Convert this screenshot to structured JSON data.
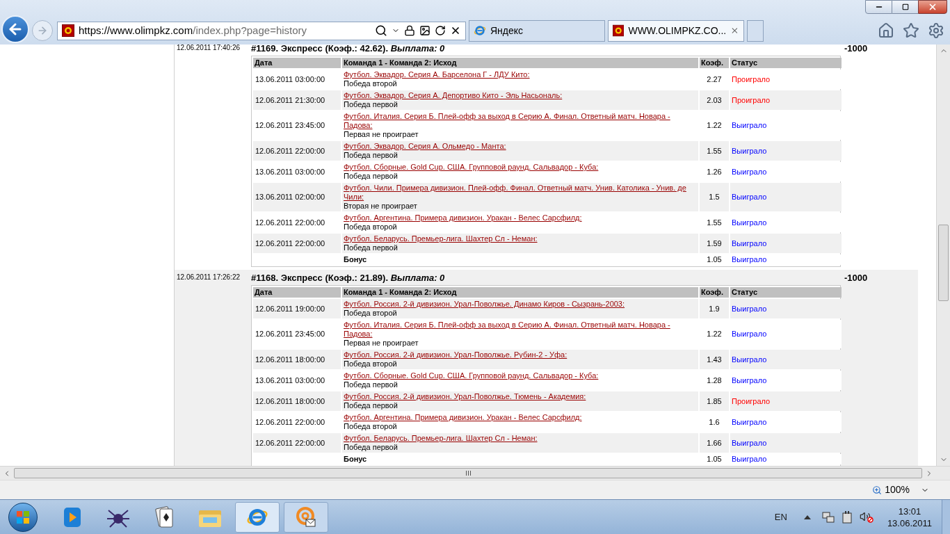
{
  "address_bar": {
    "url_host": "https://www.olimpkz.com",
    "url_path": "/index.php?page=history"
  },
  "tabs": [
    {
      "label": "Яндекс",
      "selected": false
    },
    {
      "label": "WWW.OLIMPKZ.CO...",
      "selected": true
    }
  ],
  "bets": [
    {
      "placed": "12.06.2011 17:40:26",
      "title": "#1169. Экспресс (Коэф.: 42.62).",
      "payout": "Выплата: 0",
      "amount": "-1000",
      "columns": [
        "Дата",
        "Команда 1 - Команда 2: Исход",
        "Коэф.",
        "Статус"
      ],
      "rows": [
        {
          "kind": "event",
          "date": "13.06.2011 03:00:00",
          "match": "Футбол. Эквадор. Серия А. Барселона Г - ЛДУ Кито:",
          "outcome": "Победа второй",
          "coef": "2.27",
          "status": "Проиграло",
          "won": false
        },
        {
          "kind": "event",
          "date": "12.06.2011 21:30:00",
          "match": "Футбол. Эквадор. Серия А. Депортиво Кито - Эль Насьональ:",
          "outcome": "Победа первой",
          "coef": "2.03",
          "status": "Проиграло",
          "won": false
        },
        {
          "kind": "event",
          "date": "12.06.2011 23:45:00",
          "match": "Футбол. Италия. Серия Б. Плей-офф за выход в Серию А. Финал. Ответный матч. Новара - Падова:",
          "outcome": "Первая не проиграет",
          "coef": "1.22",
          "status": "Выиграло",
          "won": true
        },
        {
          "kind": "event",
          "date": "12.06.2011 22:00:00",
          "match": "Футбол. Эквадор. Серия А. Ольмедо - Манта:",
          "outcome": "Победа первой",
          "coef": "1.55",
          "status": "Выиграло",
          "won": true
        },
        {
          "kind": "event",
          "date": "13.06.2011 03:00:00",
          "match": "Футбол. Сборные. Gold Cup. США. Групповой раунд. Сальвадор - Куба:",
          "outcome": "Победа первой",
          "coef": "1.26",
          "status": "Выиграло",
          "won": true
        },
        {
          "kind": "event",
          "date": "13.06.2011 02:00:00",
          "match": "Футбол. Чили. Примера дивизион. Плей-офф. Финал. Ответный матч. Унив. Католика - Унив. де Чили:",
          "outcome": "Вторая не проиграет",
          "coef": "1.5",
          "status": "Выиграло",
          "won": true
        },
        {
          "kind": "event",
          "date": "12.06.2011 22:00:00",
          "match": "Футбол. Аргентина. Примера дивизион. Уракан - Велес Сарсфилд:",
          "outcome": "Победа второй",
          "coef": "1.55",
          "status": "Выиграло",
          "won": true
        },
        {
          "kind": "event",
          "date": "12.06.2011 22:00:00",
          "match": "Футбол. Беларусь. Премьер-лига. Шахтер Сл - Неман:",
          "outcome": "Победа первой",
          "coef": "1.59",
          "status": "Выиграло",
          "won": true
        },
        {
          "kind": "bonus",
          "label": "Бонус",
          "coef": "1.05",
          "status": "Выиграло",
          "won": true
        }
      ]
    },
    {
      "placed": "12.06.2011 17:26:22",
      "title": "#1168. Экспресс (Коэф.: 21.89).",
      "payout": "Выплата: 0",
      "amount": "-1000",
      "columns": [
        "Дата",
        "Команда 1 - Команда 2: Исход",
        "Коэф.",
        "Статус"
      ],
      "rows": [
        {
          "kind": "event",
          "date": "12.06.2011 19:00:00",
          "match": "Футбол. Россия. 2-й дивизион. Урал-Поволжье. Динамо Киров - Сызрань-2003:",
          "outcome": "Победа второй",
          "coef": "1.9",
          "status": "Выиграло",
          "won": true
        },
        {
          "kind": "event",
          "date": "12.06.2011 23:45:00",
          "match": "Футбол. Италия. Серия Б. Плей-офф за выход в Серию А. Финал. Ответный матч. Новара - Падова:",
          "outcome": "Первая не проиграет",
          "coef": "1.22",
          "status": "Выиграло",
          "won": true
        },
        {
          "kind": "event",
          "date": "12.06.2011 18:00:00",
          "match": "Футбол. Россия. 2-й дивизион. Урал-Поволжье. Рубин-2 - Уфа:",
          "outcome": "Победа второй",
          "coef": "1.43",
          "status": "Выиграло",
          "won": true
        },
        {
          "kind": "event",
          "date": "13.06.2011 03:00:00",
          "match": "Футбол. Сборные. Gold Cup. США. Групповой раунд. Сальвадор - Куба:",
          "outcome": "Победа первой",
          "coef": "1.28",
          "status": "Выиграло",
          "won": true
        },
        {
          "kind": "event",
          "date": "12.06.2011 18:00:00",
          "match": "Футбол. Россия. 2-й дивизион. Урал-Поволжье. Тюмень - Академия:",
          "outcome": "Победа первой",
          "coef": "1.85",
          "status": "Проиграло",
          "won": false
        },
        {
          "kind": "event",
          "date": "12.06.2011 22:00:00",
          "match": "Футбол. Аргентина. Примера дивизион. Уракан - Велес Сарсфилд:",
          "outcome": "Победа второй",
          "coef": "1.6",
          "status": "Выиграло",
          "won": true
        },
        {
          "kind": "event",
          "date": "12.06.2011 22:00:00",
          "match": "Футбол. Беларусь. Премьер-лига. Шахтер Сл - Неман:",
          "outcome": "Победа первой",
          "coef": "1.66",
          "status": "Выиграло",
          "won": true
        },
        {
          "kind": "bonus",
          "label": "Бонус",
          "coef": "1.05",
          "status": "Выиграло",
          "won": true
        }
      ]
    }
  ],
  "status_bar": {
    "zoom": "100%"
  },
  "taskbar": {
    "language": "EN",
    "time": "13:01",
    "date": "13.06.2011"
  }
}
